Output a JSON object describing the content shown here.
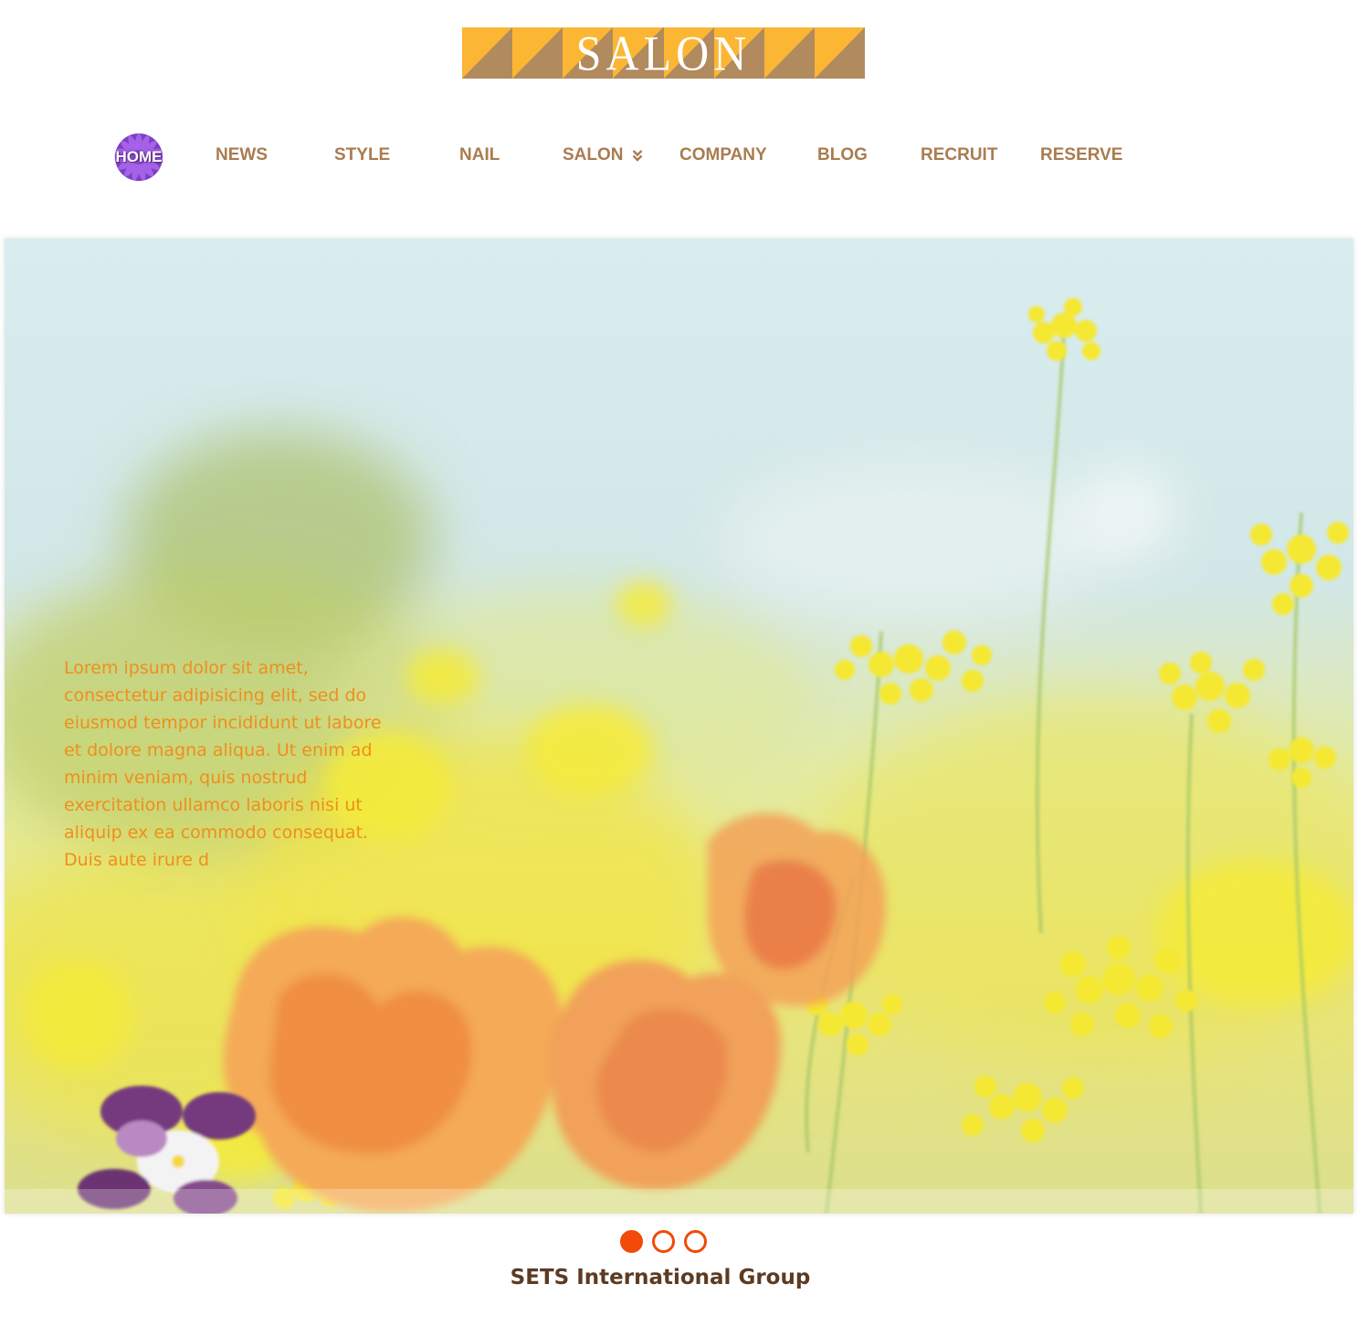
{
  "brand": {
    "logo_text": "SALON",
    "colors": {
      "logo_gold": "#fbb634",
      "logo_brown": "#b18a5e"
    }
  },
  "nav": {
    "home": {
      "label": "HOME",
      "icon": "purple-flower-icon"
    },
    "items": [
      {
        "label": "NEWS"
      },
      {
        "label": "STYLE"
      },
      {
        "label": "NAIL"
      },
      {
        "label": "SALON",
        "icon": "double-chevron-down-icon"
      },
      {
        "label": "COMPANY"
      },
      {
        "label": "BLOG"
      },
      {
        "label": "RECRUIT"
      },
      {
        "label": "RESERVE"
      }
    ],
    "color": "#a97c50"
  },
  "hero": {
    "text": "Lorem ipsum dolor sit amet, consectetur adipisicing elit, sed do eiusmod tempor incididunt ut labore et dolore magna aliqua. Ut enim ad minim veniam, quis nostrud exercitation ullamco laboris nisi ut aliquip ex ea commodo consequat. Duis aute irure d",
    "text_color": "#f08e1c"
  },
  "slider": {
    "total": 3,
    "active_index": 0,
    "color": "#f14a09"
  },
  "footer": {
    "title": "SETS International Group"
  }
}
